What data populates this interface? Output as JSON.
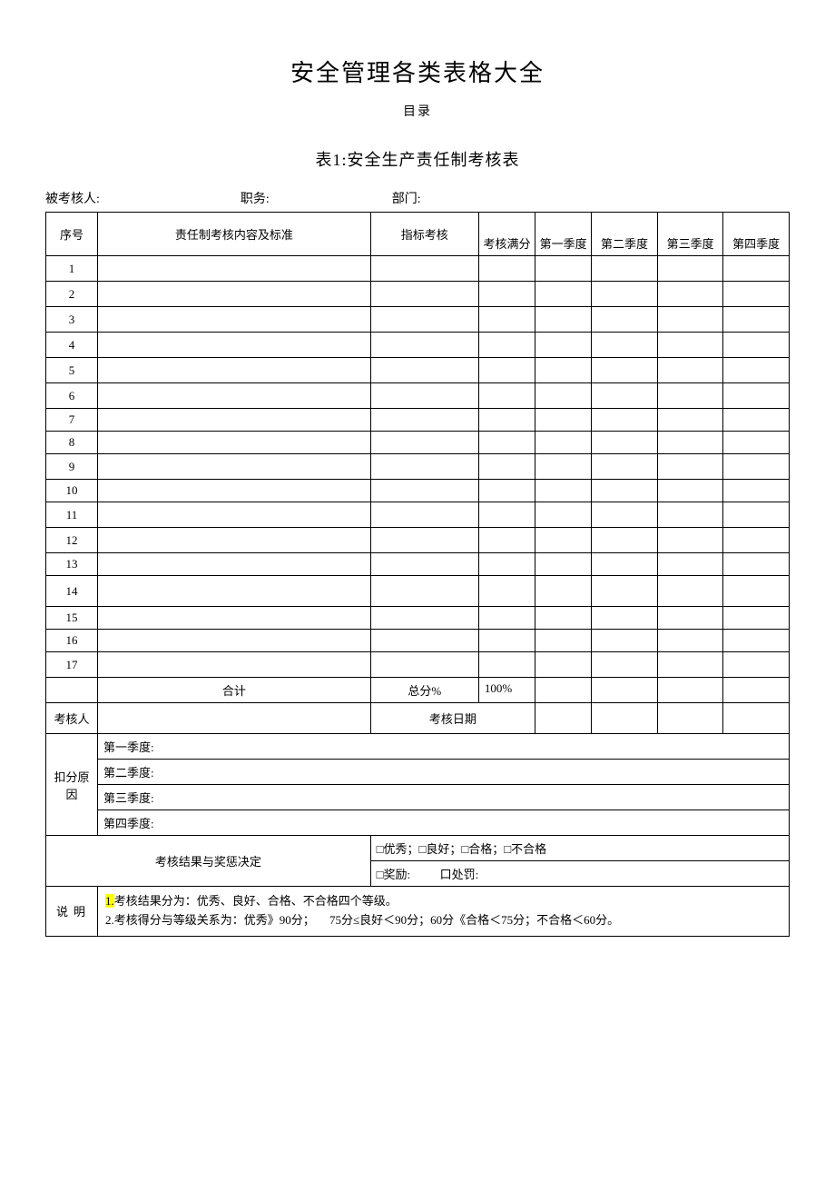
{
  "mainTitle": "安全管理各类表格大全",
  "subTitle": "目录",
  "tableTitle": "表1:安全生产责任制考核表",
  "headerLine": {
    "assesseeLabel": "被考核人:",
    "positionLabel": "职务:",
    "departmentLabel": "部门:"
  },
  "columns": {
    "seq": "序号",
    "content": "责任制考核内容及标准",
    "indicator": "指标考核",
    "fullScore": "考核满分",
    "q1": "第一季度",
    "q2": "第二季度",
    "q3": "第三季度",
    "q4": "第四季度"
  },
  "rows": [
    "1",
    "2",
    "3",
    "4",
    "5",
    "6",
    "7",
    "8",
    "9",
    "10",
    "11",
    "12",
    "13",
    "14",
    "15",
    "16",
    "17"
  ],
  "totalRow": {
    "label": "合计",
    "scoreLabel": "总分%",
    "scoreValue": "100%"
  },
  "assessorRow": {
    "assessorLabel": "考核人",
    "dateLabel": "考核日期"
  },
  "deductReason": {
    "label": "扣分原因",
    "q1": "第一季度:",
    "q2": "第二季度:",
    "q3": "第三季度:",
    "q4": "第四季度:"
  },
  "resultDecision": {
    "label": "考核结果与奖惩决定",
    "line1": "□优秀；□良好；□合格；□不合格",
    "line2a": "□奖励:",
    "line2b": "口处罚:"
  },
  "notes": {
    "label": "说明",
    "note1prefix": "1.",
    "note1": "考核结果分为：优秀、良好、合格、不合格四个等级。",
    "note2": "2.考核得分与等级关系为：优秀》90分；",
    "note2b": "75分≤良好＜90分；60分《合格＜75分；不合格＜60分。"
  }
}
